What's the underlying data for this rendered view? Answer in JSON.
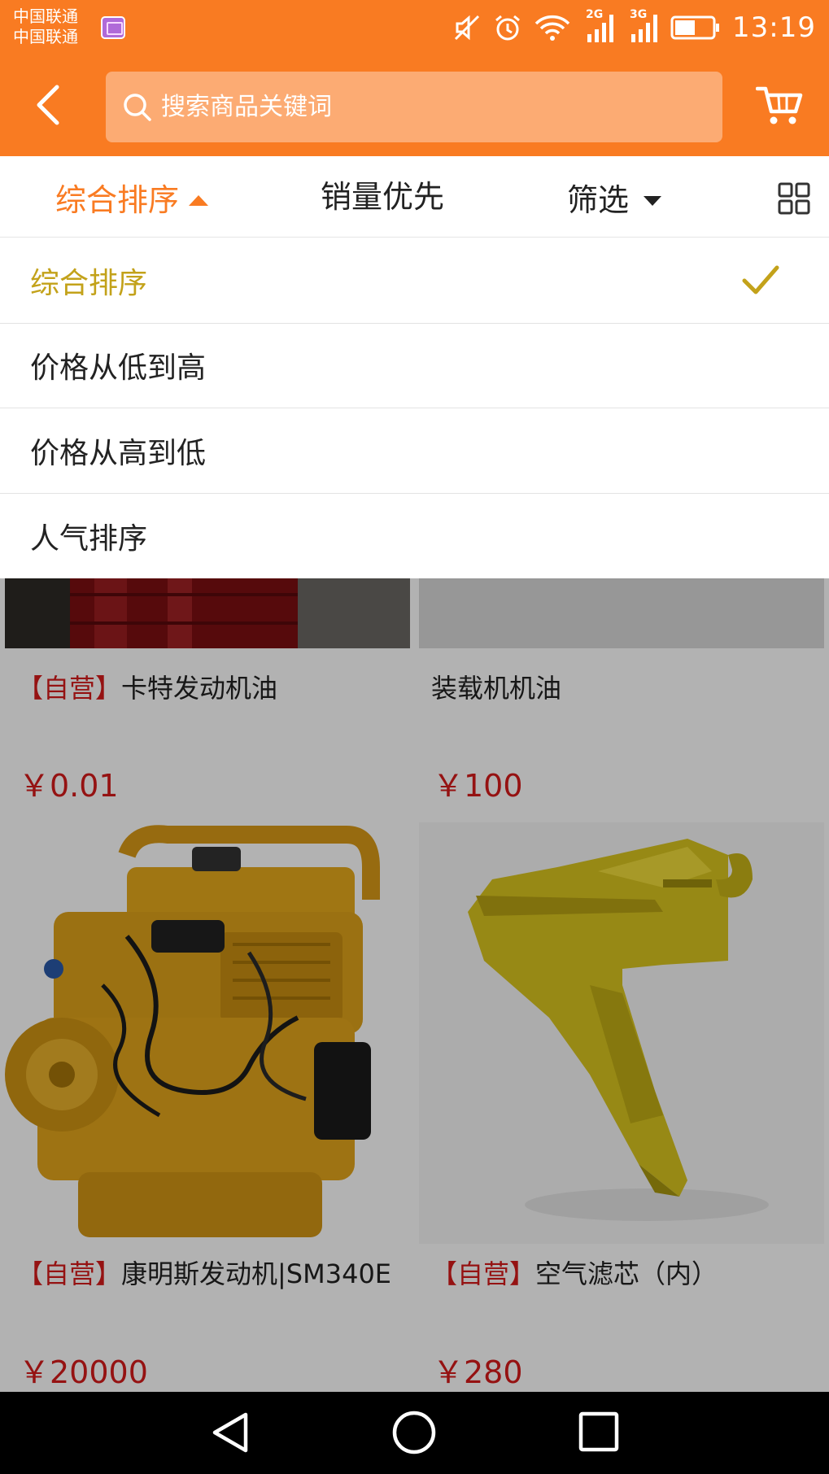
{
  "status_bar": {
    "carrier_1": "中国联通",
    "carrier_2": "中国联通",
    "network_1": "2G",
    "network_2": "3G",
    "time": "13:19"
  },
  "search": {
    "placeholder": "搜索商品关键词"
  },
  "sort_bar": {
    "comprehensive": "综合排序",
    "sales_first": "销量优先",
    "filter": "筛选"
  },
  "sort_menu": {
    "selected_index": 0,
    "items": [
      {
        "label": "综合排序"
      },
      {
        "label": "价格从低到高"
      },
      {
        "label": "价格从高到低"
      },
      {
        "label": "人气排序"
      }
    ]
  },
  "products": [
    {
      "tag": "【自营】",
      "name": "卡特发动机油",
      "price": "￥0.01"
    },
    {
      "tag": "",
      "name": "装载机机油",
      "price": "￥100"
    },
    {
      "tag": "【自营】",
      "name": "康明斯发动机|SM340E",
      "price": "￥20000"
    },
    {
      "tag": "【自营】",
      "name": "空气滤芯（内）",
      "price": "￥280"
    }
  ],
  "colors": {
    "brand_orange": "#f97b22",
    "selected_gold": "#c3a21a",
    "price_red": "#d61a1a"
  },
  "icons": {
    "back": "back-arrow-icon",
    "search": "search-icon",
    "cart": "cart-icon",
    "grid": "grid-view-icon",
    "check": "check-icon"
  }
}
